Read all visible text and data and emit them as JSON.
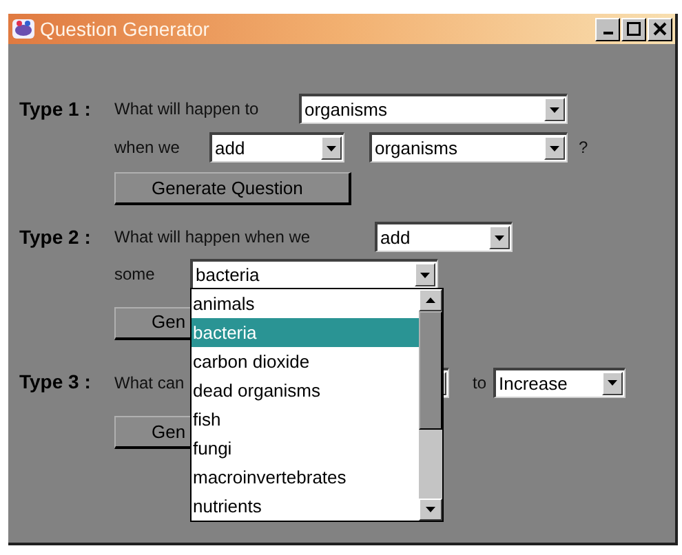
{
  "window": {
    "title": "Question Generator"
  },
  "type1": {
    "label": "Type 1 :",
    "prompt": "What will happen to",
    "target": "organisms",
    "connector": "when we",
    "action": "add",
    "object": "organisms",
    "suffix": "?",
    "button": "Generate Question"
  },
  "type2": {
    "label": "Type 2 :",
    "prompt": "What will happen when we",
    "action": "add",
    "connector": "some",
    "object": "bacteria",
    "button": "Gen"
  },
  "type3": {
    "label": "Type 3 :",
    "prompt": "What can",
    "connector": "to",
    "direction": "Increase",
    "button": "Gen"
  },
  "dropdown": {
    "items": [
      {
        "label": "animals",
        "selected": false
      },
      {
        "label": "bacteria",
        "selected": true
      },
      {
        "label": "carbon dioxide",
        "selected": false
      },
      {
        "label": "dead organisms",
        "selected": false
      },
      {
        "label": "fish",
        "selected": false
      },
      {
        "label": "fungi",
        "selected": false
      },
      {
        "label": "macroinvertebrates",
        "selected": false
      },
      {
        "label": "nutrients",
        "selected": false
      }
    ]
  }
}
